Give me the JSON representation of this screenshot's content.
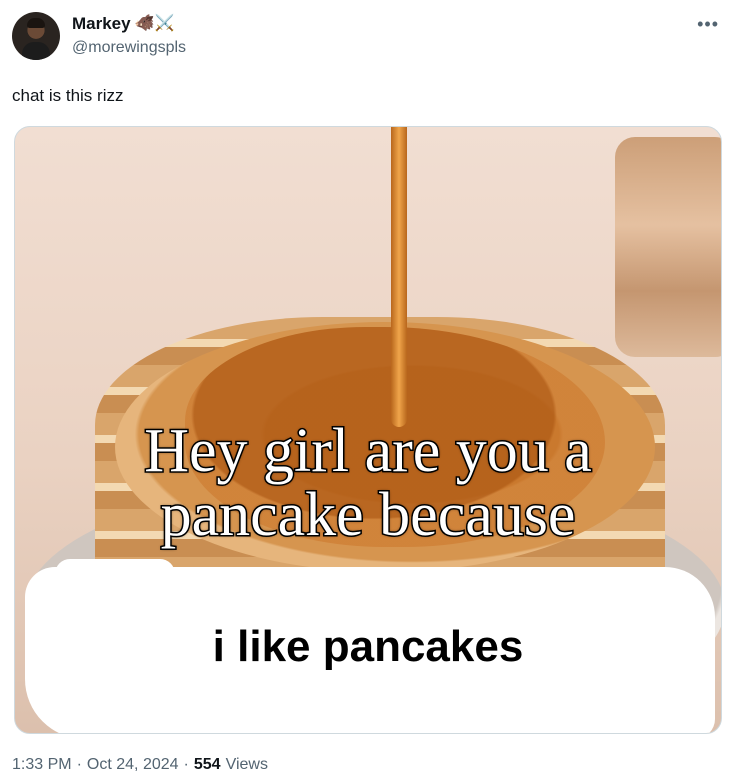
{
  "author": {
    "display_name": "Markey",
    "emojis": "🐗⚔️",
    "handle": "@morewingspls"
  },
  "more_icon": "more-horizontal-icon",
  "tweet": {
    "text": "chat is this rizz"
  },
  "media": {
    "caption_line1": "Hey girl are you a",
    "caption_line2": "pancake because",
    "punchline": "i like pancakes"
  },
  "meta": {
    "time": "1:33 PM",
    "sep1": "·",
    "date": "Oct 24, 2024",
    "sep2": "·",
    "views_count": "554",
    "views_label": "Views"
  }
}
